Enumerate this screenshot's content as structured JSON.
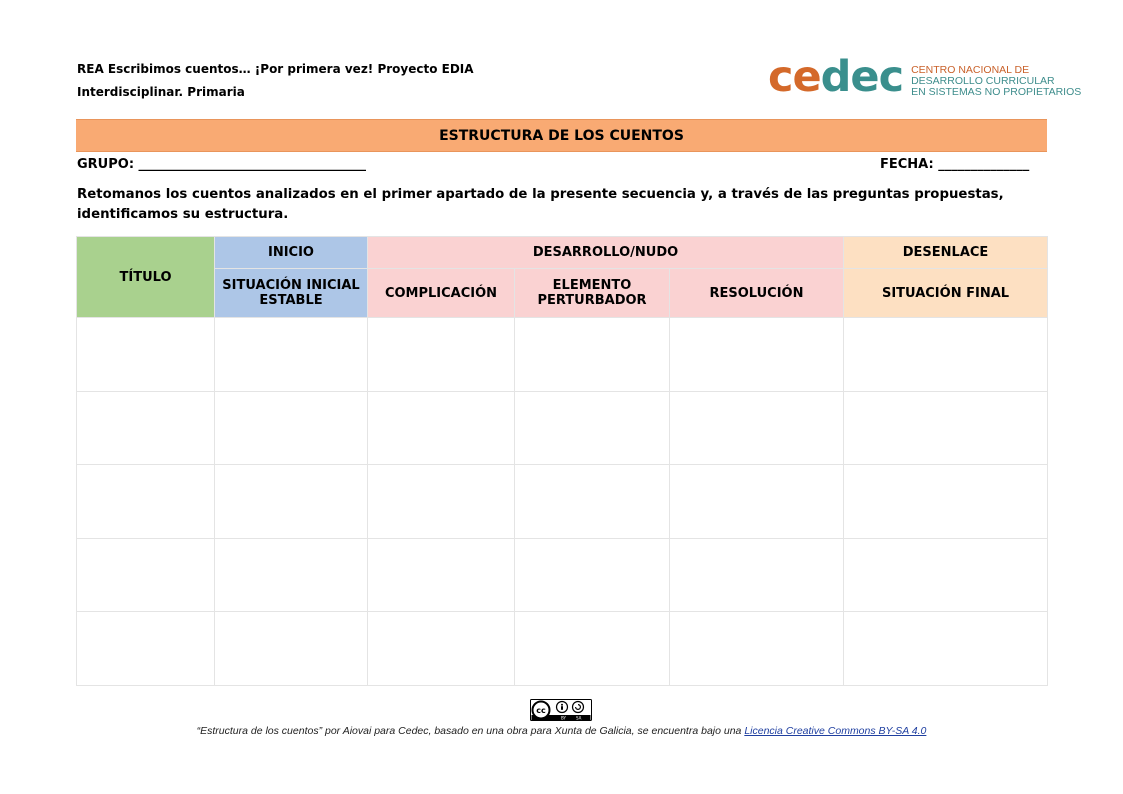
{
  "header": {
    "line1": "REA Escribimos cuentos… ¡Por primera vez! Proyecto EDIA",
    "line2": "Interdisciplinar. Primaria"
  },
  "logo": {
    "word_part1": "ce",
    "word_part2": "dec",
    "line1": "CENTRO NACIONAL DE",
    "line2": "DESARROLLO CURRICULAR",
    "line3": "EN SISTEMAS NO PROPIETARIOS",
    "color_orange": "#d4692a",
    "color_teal": "#3a8f8d"
  },
  "banner": {
    "title": "ESTRUCTURA DE LOS CUENTOS",
    "color": "#f9aa73"
  },
  "fields": {
    "grupo": "GRUPO: ___________________________________",
    "fecha": "FECHA: ______________"
  },
  "intro": "Retomanos los cuentos analizados en el primer apartado de la presente secuencia y, a través de las preguntas propuestas, identificamos su estructura.",
  "table": {
    "titulo": "TÍTULO",
    "inicio": "INICIO",
    "desarrollo": "DESARROLLO/NUDO",
    "desenlace": "DESENLACE",
    "situacion_inicial": "SITUACIÓN INICIAL ESTABLE",
    "complicacion": "COMPLICACIÓN",
    "elemento": "ELEMENTO PERTURBADOR",
    "resolucion": "RESOLUCIÓN",
    "situacion_final": "SITUACIÓN FINAL",
    "colors": {
      "titulo": "#a9d18e",
      "inicio": "#adc6e7",
      "desarrollo": "#fad2d2",
      "desenlace": "#fde0c2"
    }
  },
  "footer": {
    "badge_label": "cc BY SA",
    "text": "“Estructura de los cuentos” por Aiovai para Cedec, basado en una obra para Xunta de Galicia, se encuentra bajo una ",
    "link": "Licencia Creative Commons BY-SA 4.0"
  }
}
